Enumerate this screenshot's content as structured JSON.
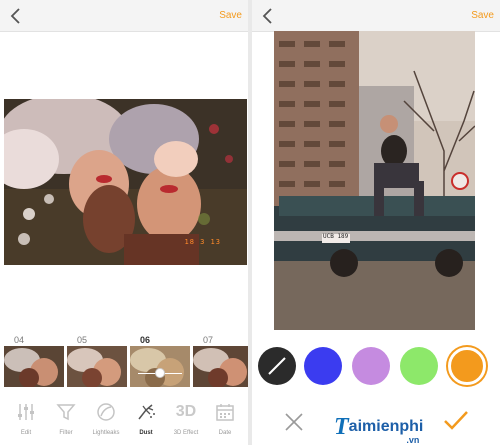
{
  "left_screen": {
    "save_label": "Save",
    "photo_stamp": "18 3 13",
    "filter_numbers": [
      {
        "label": "04",
        "active": false
      },
      {
        "label": "05",
        "active": false
      },
      {
        "label": "06",
        "active": true
      },
      {
        "label": "07",
        "active": false
      }
    ],
    "tools": [
      {
        "label": "Edit",
        "icon": "sliders-icon",
        "active": false
      },
      {
        "label": "Filter",
        "icon": "funnel-icon",
        "active": false
      },
      {
        "label": "Lightleaks",
        "icon": "lightleaks-icon",
        "active": false
      },
      {
        "label": "Dust",
        "icon": "dust-icon",
        "active": true
      },
      {
        "label": "3D Effect",
        "icon_text": "3D",
        "active": false
      },
      {
        "label": "Date",
        "icon": "calendar-icon",
        "active": false
      }
    ]
  },
  "right_screen": {
    "save_label": "Save",
    "plate_text": "UCB 189",
    "colors": [
      {
        "name": "none",
        "hex": "#2b2b2b"
      },
      {
        "name": "blue",
        "hex": "#3b3cf0"
      },
      {
        "name": "purple",
        "hex": "#c58be0"
      },
      {
        "name": "green",
        "hex": "#8de86a"
      },
      {
        "name": "orange",
        "hex": "#f39a1d"
      }
    ],
    "watermark": {
      "initial": "T",
      "text": "aimienphi",
      "suffix": ".vn"
    }
  },
  "theme": {
    "accent": "#f39a1d"
  }
}
